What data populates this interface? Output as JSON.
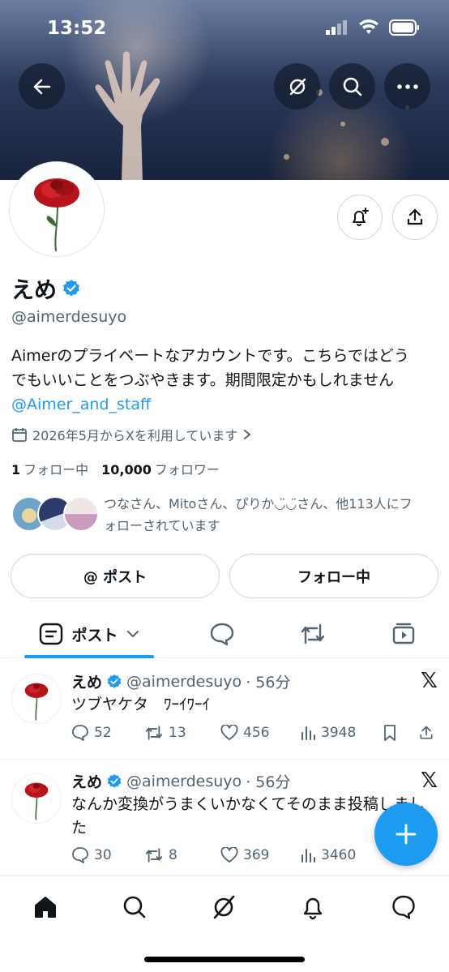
{
  "status_bar": {
    "time": "13:52"
  },
  "profile": {
    "name": "えめ",
    "handle": "@aimerdesuyo",
    "bio_line1": "Aimerのプライベートなアカウントです。こちらではどう",
    "bio_line2": "でもいいことをつぶやきます。期間限定かもしれません",
    "bio_link": "@Aimer_and_staff",
    "joined": "2026年5月からXを利用しています",
    "following_count": "1",
    "following_label": "フォロー中",
    "followers_count": "10,000",
    "followers_label": "フォロワー",
    "followed_by_line1": "つなさん、Mitoさん、ぴりか◡̈◡̈さん、他113人にフ",
    "followed_by_line2": "ォローされています"
  },
  "buttons": {
    "post_mention": "@ ポスト",
    "following": "フォロー中"
  },
  "tabs": {
    "posts": "ポスト"
  },
  "tweets": [
    {
      "name": "えめ",
      "handle": "@aimerdesuyo",
      "time": "· 56分",
      "text": "ツブヤケタ　ﾜｰｲﾜｰｲ",
      "replies": "52",
      "reposts": "13",
      "likes": "456",
      "views": "3948"
    },
    {
      "name": "えめ",
      "handle": "@aimerdesuyo",
      "time": "· 56分",
      "text": "なんか変換がうまくいかなくてそのまま投稿しました",
      "replies": "30",
      "reposts": "8",
      "likes": "369",
      "views": "3460"
    }
  ],
  "colors": {
    "accent": "#1d9bf0",
    "text": "#0f1419",
    "muted": "#536471"
  }
}
